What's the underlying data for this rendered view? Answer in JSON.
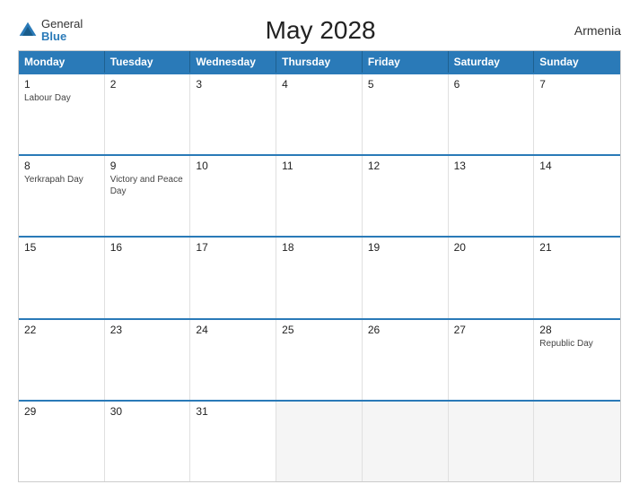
{
  "header": {
    "logo_general": "General",
    "logo_blue": "Blue",
    "title": "May 2028",
    "country": "Armenia"
  },
  "columns": [
    "Monday",
    "Tuesday",
    "Wednesday",
    "Thursday",
    "Friday",
    "Saturday",
    "Sunday"
  ],
  "weeks": [
    [
      {
        "num": "1",
        "event": "Labour Day"
      },
      {
        "num": "2",
        "event": ""
      },
      {
        "num": "3",
        "event": ""
      },
      {
        "num": "4",
        "event": ""
      },
      {
        "num": "5",
        "event": ""
      },
      {
        "num": "6",
        "event": ""
      },
      {
        "num": "7",
        "event": ""
      }
    ],
    [
      {
        "num": "8",
        "event": "Yerkrapah Day"
      },
      {
        "num": "9",
        "event": "Victory and Peace Day"
      },
      {
        "num": "10",
        "event": ""
      },
      {
        "num": "11",
        "event": ""
      },
      {
        "num": "12",
        "event": ""
      },
      {
        "num": "13",
        "event": ""
      },
      {
        "num": "14",
        "event": ""
      }
    ],
    [
      {
        "num": "15",
        "event": ""
      },
      {
        "num": "16",
        "event": ""
      },
      {
        "num": "17",
        "event": ""
      },
      {
        "num": "18",
        "event": ""
      },
      {
        "num": "19",
        "event": ""
      },
      {
        "num": "20",
        "event": ""
      },
      {
        "num": "21",
        "event": ""
      }
    ],
    [
      {
        "num": "22",
        "event": ""
      },
      {
        "num": "23",
        "event": ""
      },
      {
        "num": "24",
        "event": ""
      },
      {
        "num": "25",
        "event": ""
      },
      {
        "num": "26",
        "event": ""
      },
      {
        "num": "27",
        "event": ""
      },
      {
        "num": "28",
        "event": "Republic Day"
      }
    ],
    [
      {
        "num": "29",
        "event": ""
      },
      {
        "num": "30",
        "event": ""
      },
      {
        "num": "31",
        "event": ""
      },
      {
        "num": "",
        "event": ""
      },
      {
        "num": "",
        "event": ""
      },
      {
        "num": "",
        "event": ""
      },
      {
        "num": "",
        "event": ""
      }
    ]
  ]
}
